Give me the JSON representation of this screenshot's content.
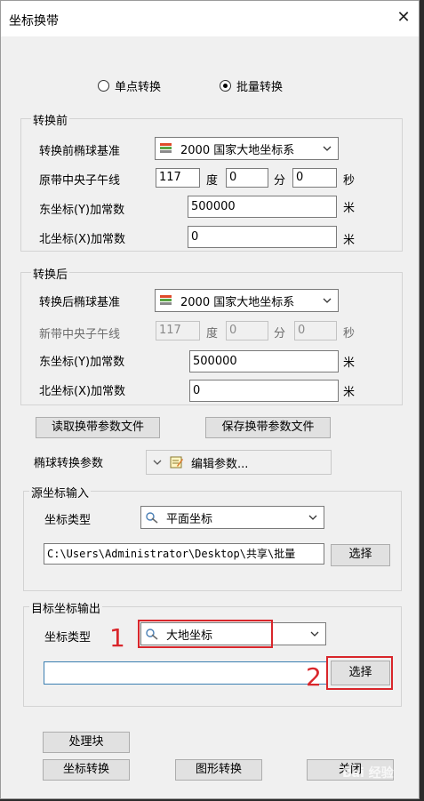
{
  "window": {
    "title": "坐标换带",
    "close_glyph": "✕"
  },
  "mode": {
    "single_label": "单点转换",
    "batch_label": "批量转换",
    "selected": "batch"
  },
  "before": {
    "legend": "转换前",
    "ellipsoid_label": "转换前椭球基准",
    "ellipsoid_value": "2000 国家大地坐标系",
    "meridian_label": "原带中央子午线",
    "meridian_deg": "117",
    "deg_unit": "度",
    "meridian_min": "0",
    "min_unit": "分",
    "meridian_sec": "0",
    "sec_unit": "秒",
    "east_label": "东坐标(Y)加常数",
    "east_value": "500000",
    "east_unit": "米",
    "north_label": "北坐标(X)加常数",
    "north_value": "0",
    "north_unit": "米"
  },
  "after": {
    "legend": "转换后",
    "ellipsoid_label": "转换后椭球基准",
    "ellipsoid_value": "2000 国家大地坐标系",
    "meridian_label": "新带中央子午线",
    "meridian_deg": "117",
    "deg_unit": "度",
    "meridian_min": "0",
    "min_unit": "分",
    "meridian_sec": "0",
    "sec_unit": "秒",
    "east_label": "东坐标(Y)加常数",
    "east_value": "500000",
    "east_unit": "米",
    "north_label": "北坐标(X)加常数",
    "north_value": "0",
    "north_unit": "米"
  },
  "param_buttons": {
    "read_label": "读取换带参数文件",
    "save_label": "保存换带参数文件"
  },
  "ellipsoid_params": {
    "label": "椭球转换参数",
    "value": "编辑参数..."
  },
  "source": {
    "legend": "源坐标输入",
    "type_label": "坐标类型",
    "type_value": "平面坐标",
    "path_value": "C:\\Users\\Administrator\\Desktop\\共享\\批量",
    "select_label": "选择"
  },
  "target": {
    "legend": "目标坐标输出",
    "type_label": "坐标类型",
    "type_value": "大地坐标",
    "path_value": "",
    "select_label": "选择"
  },
  "annotations": {
    "marker1": "1",
    "marker2": "2",
    "color": "#d9262b"
  },
  "bottom": {
    "process_label": "处理块",
    "coord_convert_label": "坐标转换",
    "graphic_convert_label": "图形转换",
    "close_label": "关闭"
  },
  "watermark": {
    "text": "Bai 经验"
  }
}
